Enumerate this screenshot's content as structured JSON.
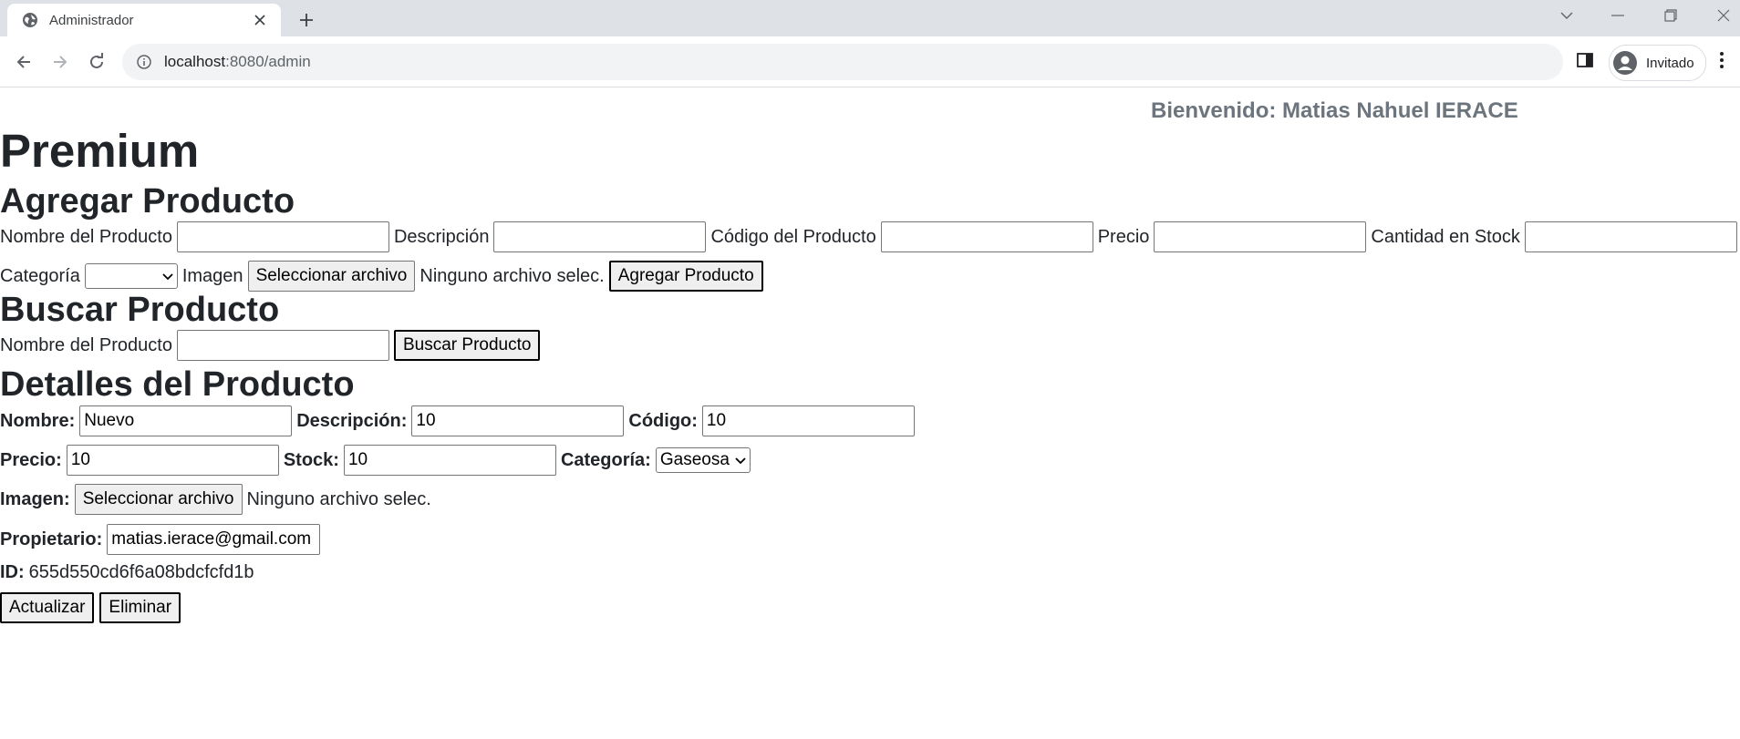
{
  "browser": {
    "tab_title": "Administrador",
    "url_host": "localhost",
    "url_path": ":8080/admin",
    "profile_label": "Invitado"
  },
  "header": {
    "welcome": "Bienvenido: Matias Nahuel IERACE",
    "brand": "Premium"
  },
  "add_product": {
    "title": "Agregar Producto",
    "name_label": "Nombre del Producto",
    "desc_label": "Descripción",
    "code_label": "Código del Producto",
    "price_label": "Precio",
    "stock_label": "Cantidad en Stock",
    "category_label": "Categoría",
    "category_value": "",
    "image_label": "Imagen",
    "file_button": "Seleccionar archivo",
    "file_status": "Ninguno archivo selec.",
    "submit": "Agregar Producto"
  },
  "search_product": {
    "title": "Buscar Producto",
    "name_label": "Nombre del Producto",
    "submit": "Buscar Producto"
  },
  "details": {
    "title": "Detalles del Producto",
    "name_label": "Nombre:",
    "name_value": "Nuevo",
    "desc_label": "Descripción:",
    "desc_value": "10",
    "code_label": "Código:",
    "code_value": "10",
    "price_label": "Precio:",
    "price_value": "10",
    "stock_label": "Stock:",
    "stock_value": "10",
    "category_label": "Categoría:",
    "category_value": "Gaseosa",
    "image_label": "Imagen:",
    "file_button": "Seleccionar archivo",
    "file_status": "Ninguno archivo selec.",
    "owner_label": "Propietario:",
    "owner_value": "matias.ierace@gmail.com",
    "id_label": "ID:",
    "id_value": "655d550cd6f6a08bdcfcfd1b",
    "update_button": "Actualizar",
    "delete_button": "Eliminar"
  },
  "colors": {
    "tabstrip": "#dee1e6",
    "omnibox": "#f1f3f4",
    "welcome_text": "#6c757d",
    "body_text": "#212529"
  },
  "icons": [
    "globe-icon",
    "close-icon",
    "plus-icon",
    "chevron-down-icon",
    "minimize-icon",
    "restore-icon",
    "window-close-icon",
    "back-icon",
    "forward-icon",
    "reload-icon",
    "info-icon",
    "side-panel-icon",
    "avatar-icon",
    "kebab-menu-icon"
  ]
}
